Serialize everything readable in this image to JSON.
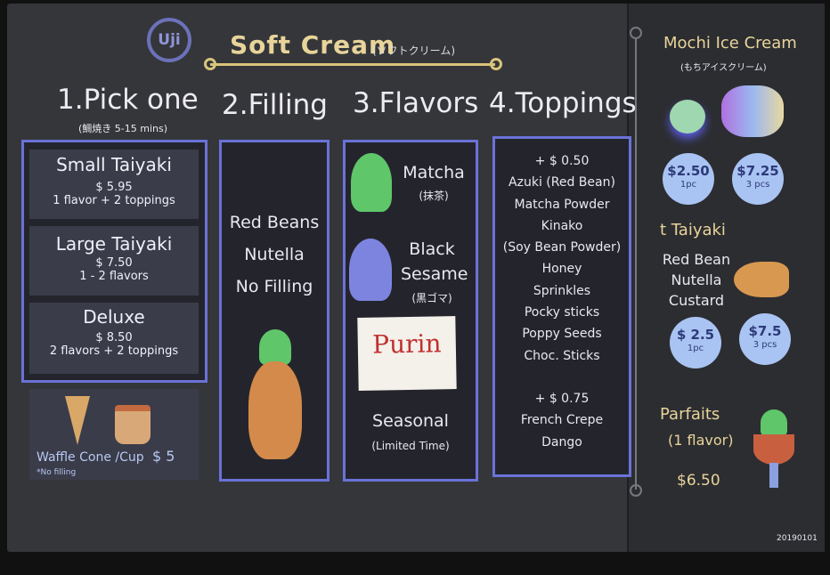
{
  "header": {
    "logo": "Uji",
    "title": "Soft Cream",
    "title_jp": "(ソフトクリーム)"
  },
  "steps": {
    "pick": {
      "title": "1.Pick one",
      "subtitle": "(鯛焼き 5-15 mins)",
      "options": [
        {
          "name": "Small Taiyaki",
          "price": "$ 5.95",
          "detail": "1 flavor + 2 toppings"
        },
        {
          "name": "Large Taiyaki",
          "price": "$ 7.50",
          "detail": "1 - 2 flavors"
        },
        {
          "name": "Deluxe",
          "price": "$ 8.50",
          "detail": "2 flavors + 2 toppings"
        }
      ],
      "cone": {
        "label": "Waffle Cone /Cup",
        "price": "$ 5",
        "note": "*No filling"
      }
    },
    "filling": {
      "title": "2.Filling",
      "items": [
        "Red Beans",
        "Nutella",
        "No Filling"
      ]
    },
    "flavors": {
      "title": "3.Flavors",
      "items": [
        {
          "name": "Matcha",
          "jp": "(抹茶)",
          "color": "#5fc66a"
        },
        {
          "name": "Black Sesame",
          "jp": "(黒ゴマ)",
          "color": "#7d84e0"
        }
      ],
      "note": "Purin",
      "seasonal": "Seasonal",
      "seasonal_sub": "(Limited Time)"
    },
    "toppings": {
      "title": "4.Toppings",
      "price1": "+ $ 0.50",
      "items1": [
        "Azuki (Red Bean)",
        "Matcha Powder",
        "Kinako",
        "(Soy Bean Powder)",
        "Honey",
        "Sprinkles",
        "Pocky sticks",
        "Poppy Seeds",
        "Choc. Sticks"
      ],
      "price2": "+ $ 0.75",
      "items2": [
        "French Crepe",
        "Dango"
      ]
    }
  },
  "side": {
    "mochi": {
      "title": "Mochi Ice Cream",
      "jp": "(もちアイスクリーム)",
      "prices": [
        {
          "price": "$2.50",
          "qty": "1pc"
        },
        {
          "price": "$7.25",
          "qty": "3 pcs"
        }
      ]
    },
    "taiyaki": {
      "title": "t Taiyaki",
      "items": [
        "Red Bean",
        "Nutella",
        "Custard"
      ],
      "prices": [
        {
          "price": "$ 2.5",
          "qty": "1pc"
        },
        {
          "price": "$7.5",
          "qty": "3 pcs"
        }
      ]
    },
    "parfaits": {
      "title": "Parfaits",
      "sub": "(1 flavor)",
      "price": "$6.50"
    }
  },
  "footer": {
    "code": "20190101"
  }
}
